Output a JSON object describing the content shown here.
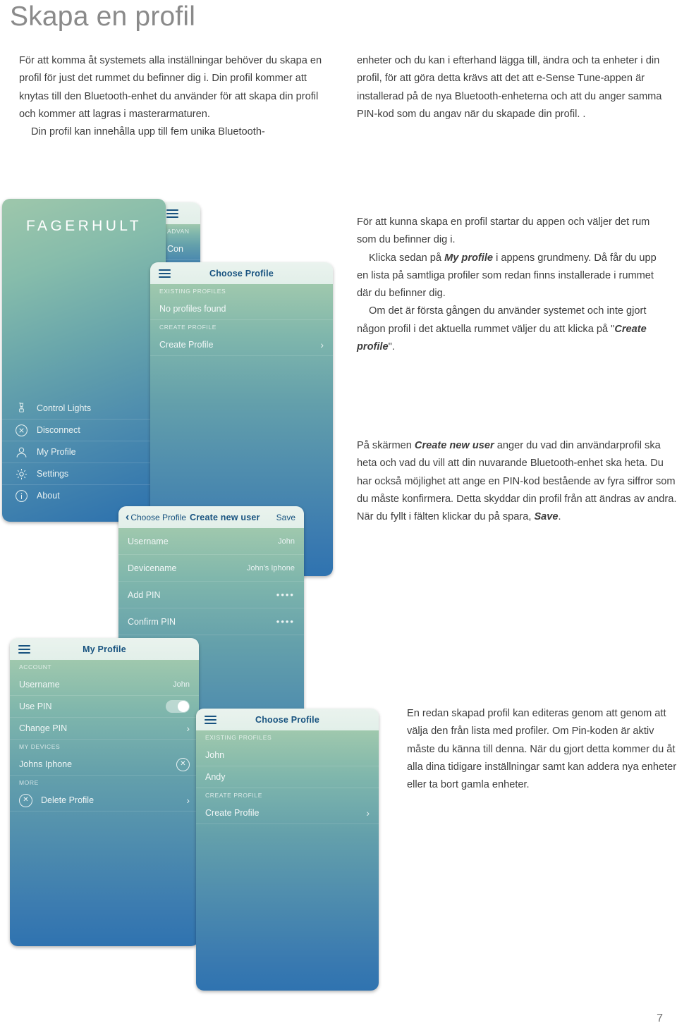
{
  "page": {
    "title": "Skapa en profil",
    "number": "7"
  },
  "intro_left": [
    "För att komma åt systemets alla inställningar behöver du skapa en profil för just det rummet du befinner dig i. Din profil kommer att knytas till den Bluetooth-enhet du använder för att skapa din profil och kommer att lagras i masterarmaturen.",
    "Din profil kan innehålla upp till fem unika Bluetooth-"
  ],
  "intro_right": [
    "enheter och du kan i efterhand lägga till, ändra och ta enheter i din profil, för att göra detta krävs att det att e-Sense Tune-appen är installerad på de nya Bluetooth-enheterna och att du anger samma PIN-kod som du angav när du skapade din profil. ."
  ],
  "body_a": {
    "p1": "För att kunna skapa en profil startar du appen och väljer det rum som du befinner dig i.",
    "p2_pre": "Klicka sedan på ",
    "p2_em": "My profile",
    "p2_post": " i appens grundmeny. Då får du upp en lista på samtliga profiler som redan finns installerade i rummet där du befinner dig.",
    "p3_pre": "Om det är första gången du använder systemet och inte gjort någon profil i det aktuella rummet väljer du att klicka på \"",
    "p3_em": "Create profile",
    "p3_post": "\"."
  },
  "body_b": {
    "pre": "På skärmen ",
    "em1": "Create new user",
    "mid": " anger du vad din användarprofil ska heta och vad du vill att din nuvarande Bluetooth-enhet ska heta. Du har också möjlighet att ange en PIN-kod bestående av fyra siffror som du måste konfirmera. Detta skyddar din profil från att ändras av andra. När du fyllt i fälten klickar du på spara, ",
    "em2": "Save",
    "post": "."
  },
  "body_c": {
    "p1": "En redan skapad profil kan editeras genom att genom att välja den från lista med profiler. Om Pin-koden är aktiv måste du känna till denna. När du gjort detta kommer du åt alla dina tidigare inställningar samt kan addera nya enheter eller ta bort gamla enheter."
  },
  "screens": {
    "menu": {
      "logo": "FAGERHULT",
      "items": [
        {
          "label": "Control Lights",
          "icon": "lamp-icon"
        },
        {
          "label": "Disconnect",
          "icon": "close-circle-icon"
        },
        {
          "label": "My Profile",
          "icon": "person-icon"
        },
        {
          "label": "Settings",
          "icon": "gear-icon"
        },
        {
          "label": "About",
          "icon": "info-icon"
        }
      ]
    },
    "advanced": {
      "section": "ADVAN",
      "row": "Con"
    },
    "choose_profile_empty": {
      "title": "Choose Profile",
      "section_existing": "EXISTING PROFILES",
      "empty_label": "No profiles found",
      "section_create": "CREATE PROFILE",
      "create_label": "Create Profile",
      "chevron": "›"
    },
    "create_new_user": {
      "back_label": "Choose Profile",
      "title": "Create new user",
      "save_label": "Save",
      "rows": [
        {
          "label": "Username",
          "value": "John"
        },
        {
          "label": "Devicename",
          "value": "John's Iphone"
        },
        {
          "label": "Add PIN",
          "value": "••••"
        },
        {
          "label": "Confirm PIN",
          "value": "••••"
        }
      ]
    },
    "my_profile": {
      "title": "My Profile",
      "section_account": "ACCOUNT",
      "username_label": "Username",
      "username_value": "John",
      "use_pin_label": "Use PIN",
      "change_pin_label": "Change PIN",
      "section_devices": "MY DEVICES",
      "device_label": "Johns Iphone",
      "section_more": "MORE",
      "delete_label": "Delete Profile",
      "chevron": "›"
    },
    "choose_profile_list": {
      "title": "Choose Profile",
      "section_existing": "EXISTING PROFILES",
      "profiles": [
        "John",
        "Andy"
      ],
      "section_create": "CREATE PROFILE",
      "create_label": "Create Profile",
      "chevron": "›"
    }
  },
  "colors": {
    "heading": "#8a8a8a",
    "app_title": "#17527f",
    "gradient_top": "#9fc8ad",
    "gradient_bottom": "#2f73b0"
  }
}
